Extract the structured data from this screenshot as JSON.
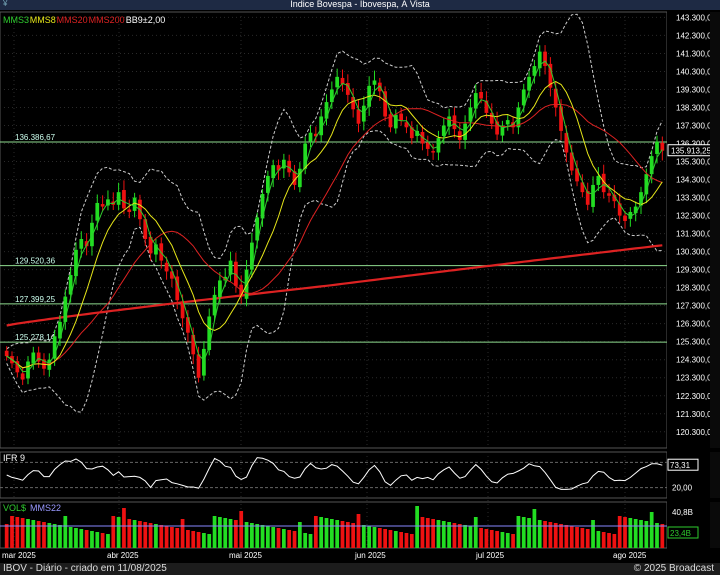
{
  "window": {
    "title": "Indice Bovespa - Ibovespa, À Vista"
  },
  "legend": [
    {
      "label": "MMS3",
      "color": "#2ecc2e"
    },
    {
      "label": "MMS8",
      "color": "#e6e619"
    },
    {
      "label": "MMS20",
      "color": "#dd2222"
    },
    {
      "label": "MMS200",
      "color": "#dd2222"
    },
    {
      "label": "BB9±2,00",
      "color": "#ffffff"
    }
  ],
  "colors": {
    "up": "#22dd22",
    "down": "#ee1111",
    "background": "#000000",
    "grid": "#2a2a2a"
  },
  "chart_data": [
    {
      "type": "candlestick",
      "x_labels": [
        "mar 2025",
        "abr 2025",
        "mai 2025",
        "jun 2025",
        "jul 2025",
        "ago 2025"
      ],
      "y_ticks": [
        "143.300,00",
        "142.300,00",
        "141.300,00",
        "140.300,00",
        "139.300,00",
        "138.300,00",
        "137.300,00",
        "136.300,00",
        "135.300,00",
        "134.300,00",
        "133.300,00",
        "132.300,00",
        "131.300,00",
        "130.300,00",
        "129.300,00",
        "128.300,00",
        "127.300,00",
        "126.300,00",
        "125.300,00",
        "124.300,00",
        "123.300,00",
        "122.300,00",
        "121.300,00",
        "120.300,00"
      ],
      "ylim": [
        119400,
        143600
      ],
      "last_value": "135.913,25",
      "hlines": [
        {
          "label": "136.386,67",
          "value": 136386.67
        },
        {
          "label": "129.520,36",
          "value": 129520.36
        },
        {
          "label": "127.399,25",
          "value": 127399.25
        },
        {
          "label": "125.278,14",
          "value": 125278.14
        }
      ],
      "series": [
        {
          "name": "MMS3",
          "kind": "line"
        },
        {
          "name": "MMS8",
          "kind": "line"
        },
        {
          "name": "MMS20",
          "kind": "line"
        },
        {
          "name": "MMS200",
          "kind": "line"
        },
        {
          "name": "BB9±2,00",
          "kind": "bands"
        }
      ],
      "closes": [
        124500,
        124100,
        123600,
        123200,
        124200,
        124700,
        124200,
        123800,
        124300,
        125600,
        126400,
        127800,
        129000,
        130400,
        131000,
        130600,
        131900,
        133000,
        132800,
        133200,
        132900,
        133600,
        132700,
        132500,
        133300,
        132100,
        131000,
        130200,
        130700,
        129800,
        129200,
        128800,
        127600,
        126600,
        125800,
        124600,
        123300,
        124900,
        126700,
        127900,
        128700,
        128900,
        129800,
        128400,
        127800,
        129300,
        130800,
        132200,
        133500,
        134500,
        135100,
        134800,
        135400,
        134700,
        134000,
        134900,
        136300,
        136900,
        136700,
        137800,
        138600,
        139300,
        140000,
        139600,
        139000,
        138200,
        137400,
        138400,
        139500,
        139800,
        139200,
        137800,
        137200,
        137900,
        137600,
        137200,
        136600,
        137000,
        136300,
        136000,
        135800,
        136600,
        137300,
        137800,
        137100,
        136500,
        137400,
        138300,
        139100,
        138800,
        138000,
        137400,
        136800,
        137300,
        137600,
        137200,
        138300,
        139300,
        140000,
        140600,
        141400,
        140600,
        139400,
        138300,
        137000,
        135800,
        134800,
        134200,
        133600,
        132900,
        134000,
        134500,
        133600,
        133400,
        133100,
        132300,
        132000,
        132500,
        132800,
        133600,
        134600,
        135600,
        136400,
        135900
      ],
      "ifr": {
        "label": "IFR 9",
        "last_value": "73,31",
        "level_label": "20,00"
      },
      "volume": {
        "label": "VOL$",
        "ma_label": "MMS22",
        "axis_label": "40,8B",
        "last_value": "23,4B"
      }
    }
  ],
  "footer": {
    "left": "IBOV - Diário - criado em 11/08/2025",
    "right": "© 2025 Broadcast"
  }
}
